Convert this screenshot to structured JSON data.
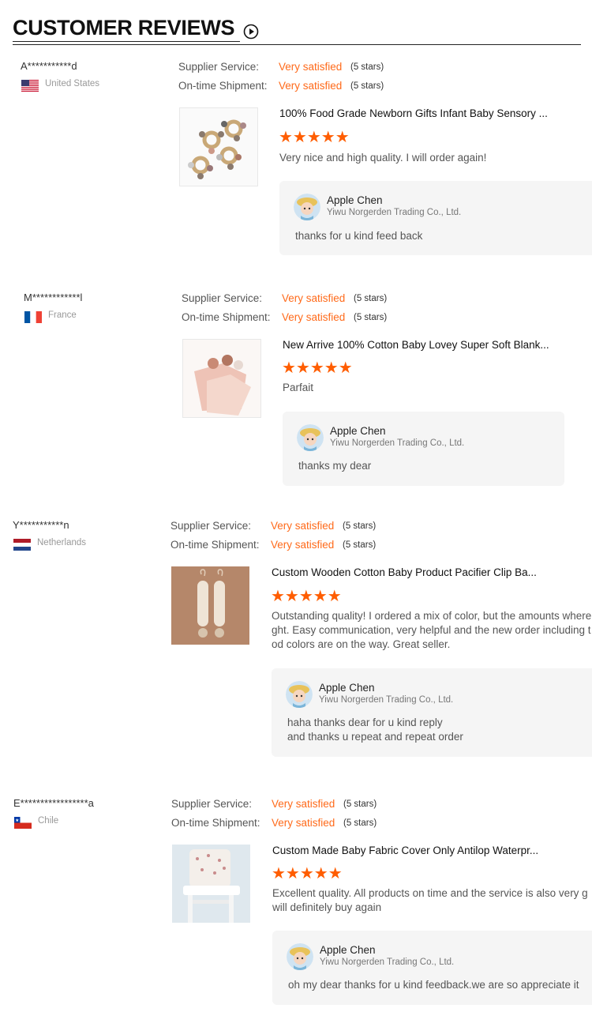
{
  "header": {
    "title": "CUSTOMER REVIEWS",
    "play_icon": "play-circle-icon"
  },
  "labels": {
    "supplier_service": "Supplier Service:",
    "ontime_shipment": "On-time Shipment:"
  },
  "colors": {
    "accent": "#ff6a1a",
    "star": "#ff5d00",
    "reply_bg": "#f5f5f5"
  },
  "reviews": [
    {
      "reviewer": "A***********d",
      "country": "United States",
      "flag": "us-flag-icon",
      "supplier_service": {
        "value": "Very satisfied",
        "stars": "(5 stars)"
      },
      "ontime_shipment": {
        "value": "Very satisfied",
        "stars": "(5 stars)"
      },
      "product_title": "100% Food Grade Newborn Gifts Infant Baby Sensory ...",
      "rating": 5,
      "stars_text": "★★★★★",
      "text": [
        "Very nice and high quality. I will order again!"
      ],
      "reply": {
        "name": "Apple Chen",
        "company": "Yiwu Norgerden Trading Co., Ltd.",
        "text": [
          "thanks for u kind feed back"
        ]
      }
    },
    {
      "reviewer": "M************l",
      "country": "France",
      "flag": "france-flag-icon",
      "supplier_service": {
        "value": "Very satisfied",
        "stars": "(5 stars)"
      },
      "ontime_shipment": {
        "value": "Very satisfied",
        "stars": "(5 stars)"
      },
      "product_title": "New Arrive 100% Cotton Baby Lovey Super Soft Blank...",
      "rating": 5,
      "stars_text": "★★★★★",
      "text": [
        "Parfait"
      ],
      "reply": {
        "name": "Apple Chen",
        "company": "Yiwu Norgerden Trading Co., Ltd.",
        "text": [
          "thanks my dear"
        ]
      }
    },
    {
      "reviewer": "Y***********n",
      "country": "Netherlands",
      "flag": "netherlands-flag-icon",
      "supplier_service": {
        "value": "Very satisfied",
        "stars": "(5 stars)"
      },
      "ontime_shipment": {
        "value": "Very satisfied",
        "stars": "(5 stars)"
      },
      "product_title": "Custom Wooden Cotton Baby Product Pacifier Clip Ba...",
      "rating": 5,
      "stars_text": "★★★★★",
      "text": [
        "Outstanding quality! I ordered a mix of color, but the amounts where",
        "ght. Easy communication, very helpful and the new order including t",
        "od colors are on the way. Great seller."
      ],
      "reply": {
        "name": "Apple Chen",
        "company": "Yiwu Norgerden Trading Co., Ltd.",
        "text": [
          "haha thanks dear for u kind reply",
          "and thanks u repeat and repeat order"
        ]
      }
    },
    {
      "reviewer": "E*****************a",
      "country": "Chile",
      "flag": "chile-flag-icon",
      "supplier_service": {
        "value": "Very satisfied",
        "stars": "(5 stars)"
      },
      "ontime_shipment": {
        "value": "Very satisfied",
        "stars": "(5 stars)"
      },
      "product_title": "Custom Made Baby Fabric Cover Only Antilop Waterpr...",
      "rating": 5,
      "stars_text": "★★★★★",
      "text": [
        "Excellent quality. All products on time and the service is also very g",
        "will definitely buy again"
      ],
      "reply": {
        "name": "Apple Chen",
        "company": "Yiwu Norgerden Trading Co., Ltd.",
        "text": [
          "oh my dear thanks for u kind feedback.we are so appreciate it"
        ]
      }
    }
  ]
}
